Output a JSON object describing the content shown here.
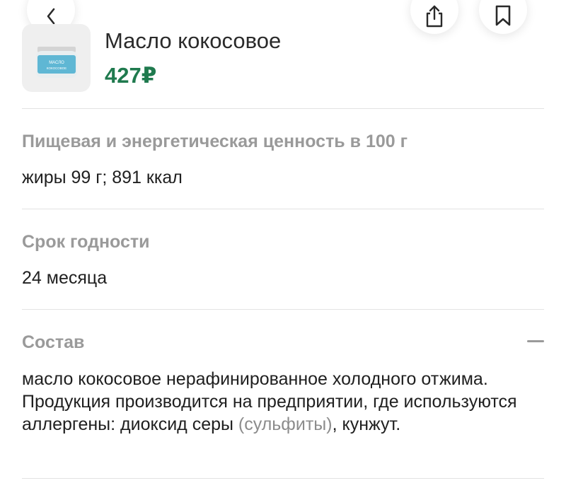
{
  "header": {
    "back_icon": "chevron-left-icon",
    "share_icon": "share-icon",
    "bookmark_icon": "bookmark-icon"
  },
  "product": {
    "title": "Масло кокосовое",
    "price": "427₽",
    "price_color": "#1f7a4e",
    "image_label_line1": "МАСЛО",
    "image_label_line2": "КОКОСОВОЕ"
  },
  "nutrition": {
    "title": "Пищевая и энергетическая ценность в 100 г",
    "value": "жиры 99 г; 891 ккал"
  },
  "shelf_life": {
    "title": "Срок годности",
    "value": "24 месяца"
  },
  "composition": {
    "title": "Состав",
    "toggle_icon": "minus-icon",
    "text_part1": "масло кокосовое нерафинированное холодного отжима. Продукция производится на предприятии, где используются аллергены: диоксид серы ",
    "text_highlight": "(сульфиты)",
    "text_part2": ", кунжут."
  }
}
